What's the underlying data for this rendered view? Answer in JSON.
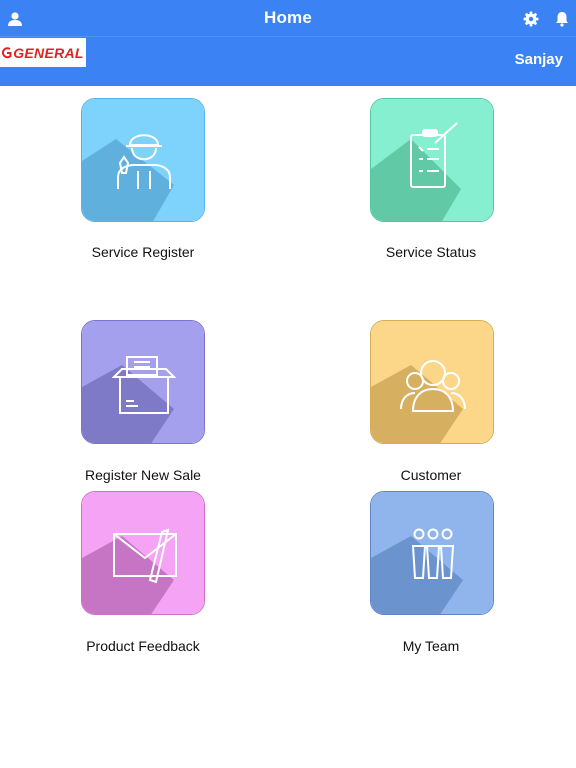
{
  "header": {
    "title": "Home",
    "username": "Sanjay",
    "logo_text": "GENERAL",
    "background_color": "#3b82f5",
    "icons": [
      "user-icon",
      "gear-icon",
      "bell-icon"
    ]
  },
  "tiles": [
    {
      "label": "Service Register",
      "icon": "technician-icon",
      "color": "#7dd3fc"
    },
    {
      "label": "Service Status",
      "icon": "checklist-icon",
      "color": "#86efcf"
    },
    {
      "label": "Register New Sale",
      "icon": "box-icon",
      "color": "#a5a0ee"
    },
    {
      "label": "Customer",
      "icon": "customers-icon",
      "color": "#fcd78a"
    },
    {
      "label": "Product Feedback",
      "icon": "envelope-icon",
      "color": "#f5a3f5"
    },
    {
      "label": "My Team",
      "icon": "team-icon",
      "color": "#8fb5ec"
    }
  ]
}
